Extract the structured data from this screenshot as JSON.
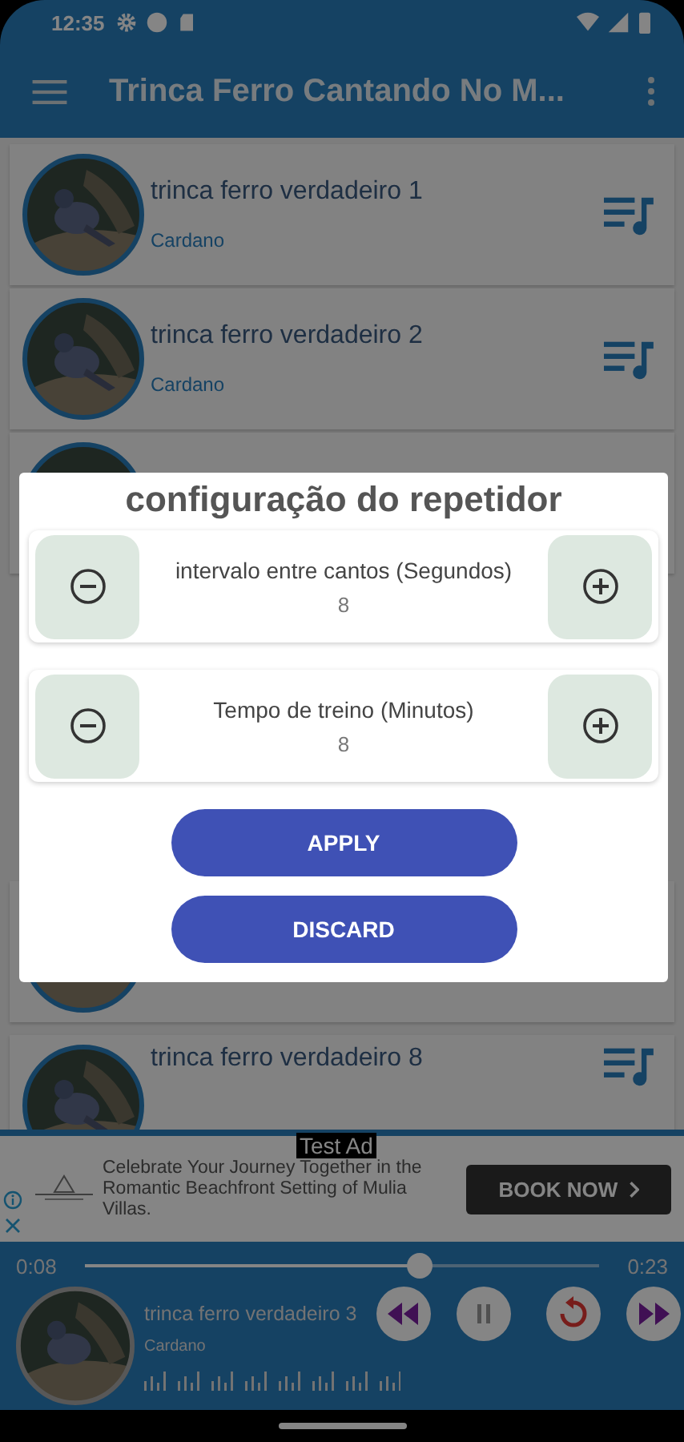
{
  "status_bar": {
    "time": "12:35"
  },
  "app_bar": {
    "title": "Trinca Ferro Cantando No M..."
  },
  "tracks": [
    {
      "kind": "track",
      "title": "trinca ferro verdadeiro 1",
      "artist": "Cardano"
    },
    {
      "kind": "track",
      "title": "trinca ferro verdadeiro 2",
      "artist": "Cardano"
    },
    {
      "kind": "covered"
    },
    {
      "kind": "covered"
    },
    {
      "kind": "track",
      "title": "trinca ferro verdadeiro 8"
    }
  ],
  "dialog": {
    "title": "configuração do repetidor",
    "settings": [
      {
        "label": "intervalo entre cantos (Segundos)",
        "value": "8"
      },
      {
        "label": "Tempo de treino (Minutos)",
        "value": "8"
      }
    ],
    "buttons": [
      "APPLY",
      "DISCARD"
    ]
  },
  "ad": {
    "badge": "Test Ad",
    "text": "Celebrate Your Journey Together in the Romantic Beachfront Setting of Mulia Villas.",
    "button": "BOOK NOW"
  },
  "player": {
    "elapsed": "0:08",
    "total": "0:23",
    "level": 0.65,
    "title": "trinca ferro verdadeiro 3",
    "artist": "Cardano",
    "playing": true
  }
}
